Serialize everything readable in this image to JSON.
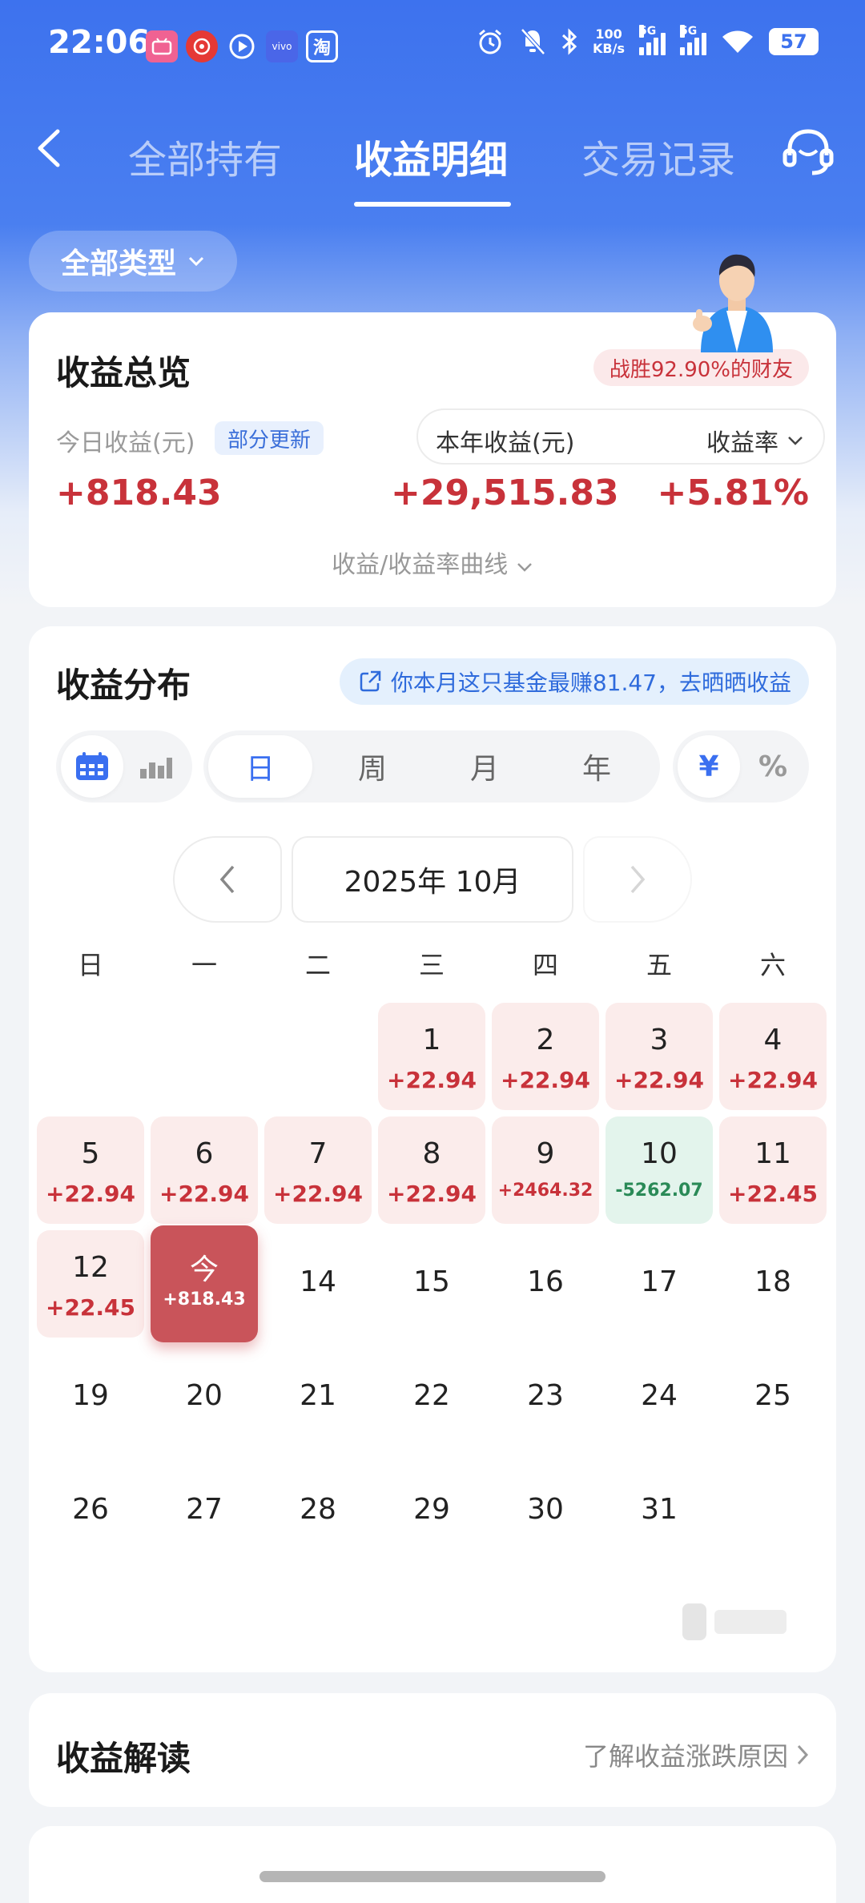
{
  "status_bar": {
    "time": "22:06",
    "net_speed_top": "100",
    "net_speed_bottom": "KB/s",
    "sim1": "5G",
    "sim2": "5G",
    "battery": "57",
    "app_icons": [
      "bilibili-icon",
      "game-icon",
      "video-icon",
      "vivo-icon",
      "taobao-icon"
    ],
    "taobao_glyph": "淘",
    "vivo_text": "vivo"
  },
  "nav": {
    "tabs": [
      {
        "label": "全部持有",
        "active": false
      },
      {
        "label": "收益明细",
        "active": true
      },
      {
        "label": "交易记录",
        "active": false
      }
    ]
  },
  "filter": {
    "type_label": "全部类型"
  },
  "overview": {
    "title": "收益总览",
    "rank_badge": "战胜92.90%的财友",
    "today_label": "今日收益(元)",
    "partial_update": "部分更新",
    "year_label": "本年收益(元)",
    "rate_label": "收益率",
    "today_value": "+818.43",
    "year_value": "+29,515.83",
    "rate_value": "+5.81%",
    "curve_link": "收益/收益率曲线"
  },
  "distribution": {
    "title": "收益分布",
    "promo": "你本月这只基金最赚81.47，去晒晒收益",
    "period_tabs": [
      "日",
      "周",
      "月",
      "年"
    ],
    "period_selected": "日",
    "unit_tabs": [
      "¥",
      "%"
    ],
    "unit_selected": "¥",
    "view_selected": "calendar",
    "month_label": "2025年 10月",
    "weekdays": [
      "日",
      "一",
      "二",
      "三",
      "四",
      "五",
      "六"
    ],
    "days": [
      {
        "d": "1",
        "v": "+22.94",
        "s": "pos"
      },
      {
        "d": "2",
        "v": "+22.94",
        "s": "pos"
      },
      {
        "d": "3",
        "v": "+22.94",
        "s": "pos"
      },
      {
        "d": "4",
        "v": "+22.94",
        "s": "pos"
      },
      {
        "d": "5",
        "v": "+22.94",
        "s": "pos"
      },
      {
        "d": "6",
        "v": "+22.94",
        "s": "pos"
      },
      {
        "d": "7",
        "v": "+22.94",
        "s": "pos"
      },
      {
        "d": "8",
        "v": "+22.94",
        "s": "pos"
      },
      {
        "d": "9",
        "v": "+2464.32",
        "s": "pos"
      },
      {
        "d": "10",
        "v": "-5262.07",
        "s": "neg"
      },
      {
        "d": "11",
        "v": "+22.45",
        "s": "pos"
      },
      {
        "d": "12",
        "v": "+22.45",
        "s": "pos"
      },
      {
        "d": "今",
        "v": "+818.43",
        "s": "today"
      },
      {
        "d": "14",
        "v": "",
        "s": "none"
      },
      {
        "d": "15",
        "v": "",
        "s": "none"
      },
      {
        "d": "16",
        "v": "",
        "s": "none"
      },
      {
        "d": "17",
        "v": "",
        "s": "none"
      },
      {
        "d": "18",
        "v": "",
        "s": "none"
      },
      {
        "d": "19",
        "v": "",
        "s": "none"
      },
      {
        "d": "20",
        "v": "",
        "s": "none"
      },
      {
        "d": "21",
        "v": "",
        "s": "none"
      },
      {
        "d": "22",
        "v": "",
        "s": "none"
      },
      {
        "d": "23",
        "v": "",
        "s": "none"
      },
      {
        "d": "24",
        "v": "",
        "s": "none"
      },
      {
        "d": "25",
        "v": "",
        "s": "none"
      },
      {
        "d": "26",
        "v": "",
        "s": "none"
      },
      {
        "d": "27",
        "v": "",
        "s": "none"
      },
      {
        "d": "28",
        "v": "",
        "s": "none"
      },
      {
        "d": "29",
        "v": "",
        "s": "none"
      },
      {
        "d": "30",
        "v": "",
        "s": "none"
      },
      {
        "d": "31",
        "v": "",
        "s": "none"
      }
    ],
    "first_weekday_index": 3
  },
  "interpretation": {
    "title": "收益解读",
    "link": "了解收益涨跌原因"
  },
  "colors": {
    "brand_blue": "#3d72ee",
    "gain_red": "#c8323a",
    "loss_green": "#2a8a57",
    "today_red": "#c9545a"
  }
}
